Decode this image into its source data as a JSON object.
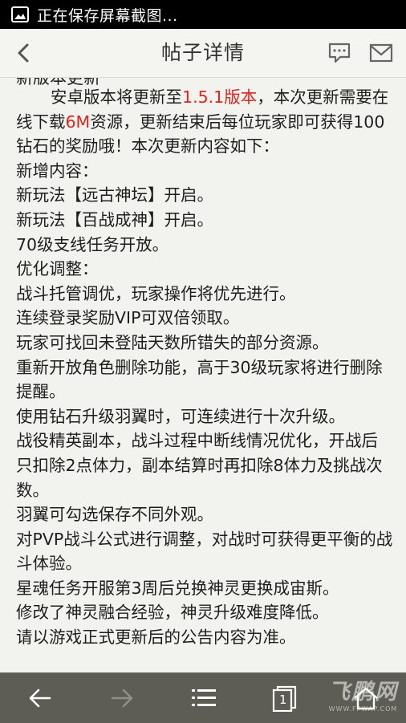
{
  "status_bar": {
    "text": "正在保存屏幕截图..."
  },
  "header": {
    "title": "帖子详情"
  },
  "article": {
    "partial_top": "新版本更新",
    "intro_before": "安卓版本将更新至",
    "version": "1.5.1版本",
    "intro_middle": "，本次更新需要在线下载",
    "size": "6M",
    "intro_after": "资源，更新结束后每位玩家即可获得100钻石的奖励哦！本次更新内容如下：",
    "lines": [
      "新增内容：",
      "新玩法【远古神坛】开启。",
      "新玩法【百战成神】开启。",
      "70级支线任务开放。",
      "优化调整：",
      "战斗托管调优，玩家操作将优先进行。",
      "连续登录奖励VIP可双倍领取。",
      "玩家可找回未登陆天数所错失的部分资源。",
      "重新开放角色删除功能，高于30级玩家将进行删除提醒。",
      "使用钻石升级羽翼时，可连续进行十次升级。",
      "战役精英副本，战斗过程中断线情况优化，开战后只扣除2点体力，副本结算时再扣除8体力及挑战次数。",
      "羽翼可勾选保存不同外观。",
      "对PVP战斗公式进行调整，对战时可获得更平衡的战斗体验。",
      "星魂任务开服第3周后兑换神灵更换成宙斯。",
      "修改了神灵融合经验，神灵升级难度降低。",
      "请以游戏正式更新后的公告内容为准。"
    ]
  },
  "nav": {
    "tabs_count": "1"
  },
  "watermark": {
    "main": "飞鹏网",
    "sub": "WWW.FPWAP.COM"
  },
  "colors": {
    "highlight": "#e0241e",
    "nav_bg": "#5d5d55",
    "page_bg": "#f2f2ee"
  },
  "icons": [
    "picture-icon",
    "back-arrow-icon",
    "comment-icon",
    "mail-icon",
    "nav-back-icon",
    "nav-forward-icon",
    "menu-icon",
    "tabs-icon",
    "home-icon"
  ]
}
